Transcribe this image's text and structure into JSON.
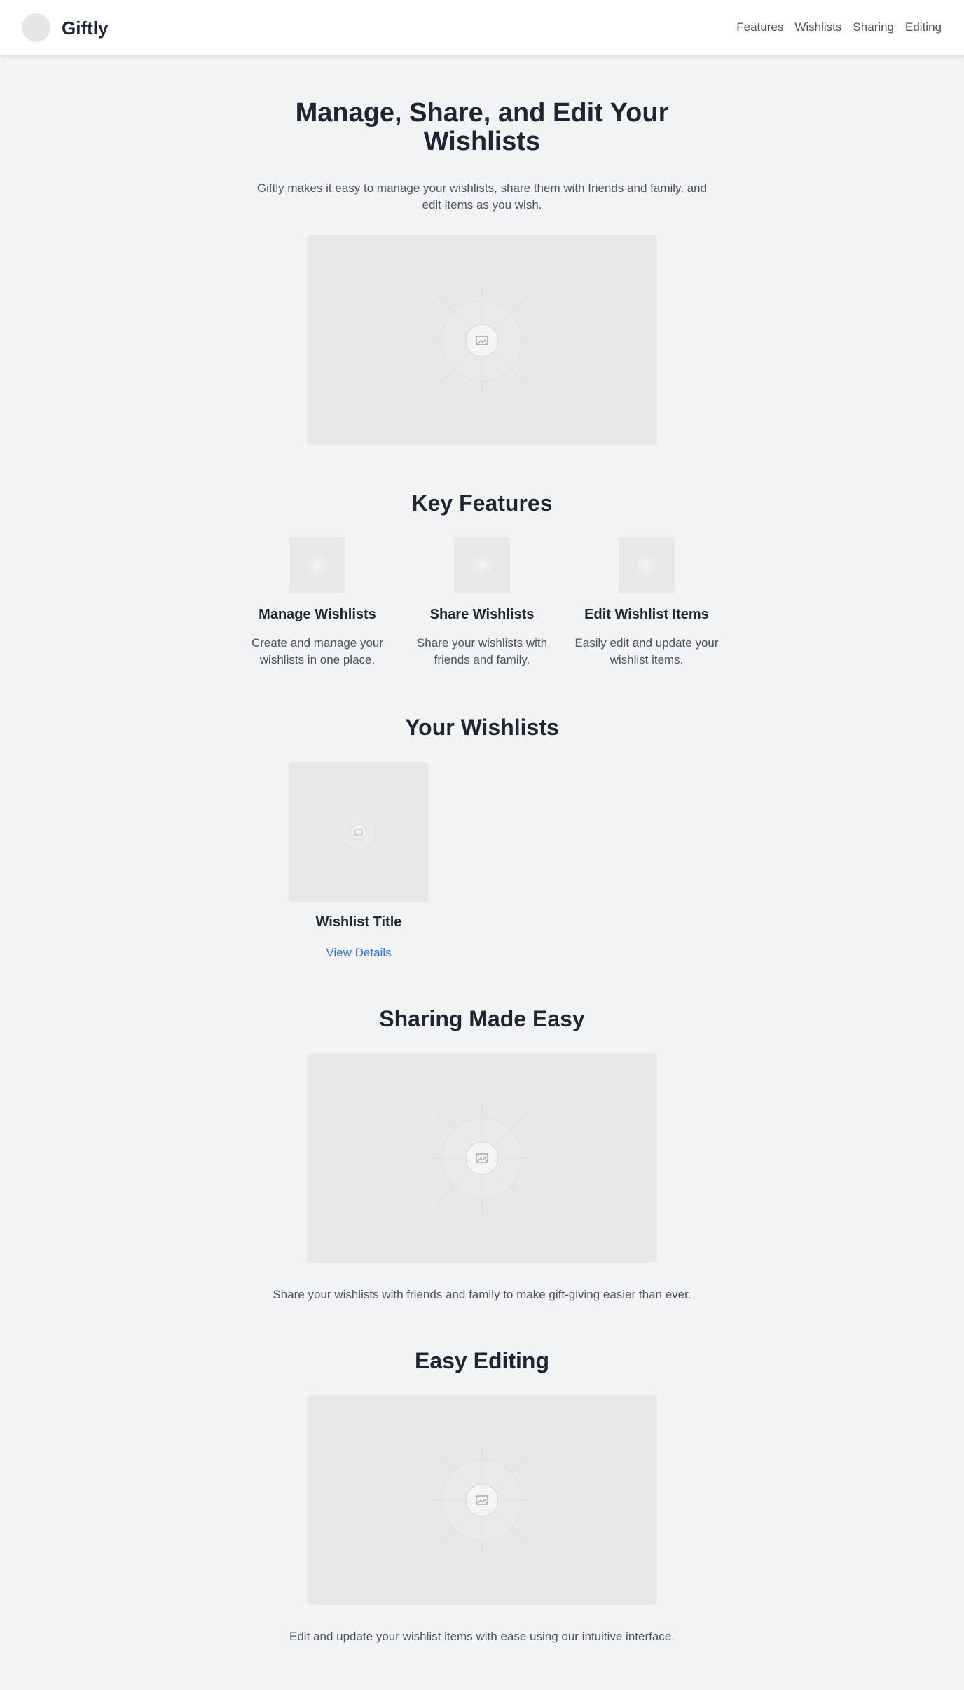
{
  "header": {
    "brand": "Giftly",
    "nav": [
      "Features",
      "Wishlists",
      "Sharing",
      "Editing"
    ]
  },
  "hero": {
    "title": "Manage, Share, and Edit Your Wishlists",
    "subtitle": "Giftly makes it easy to manage your wishlists, share them with friends and family, and edit items as you wish."
  },
  "features": {
    "title": "Key Features",
    "items": [
      {
        "title": "Manage Wishlists",
        "desc": "Create and manage your wishlists in one place."
      },
      {
        "title": "Share Wishlists",
        "desc": "Share your wishlists with friends and family."
      },
      {
        "title": "Edit Wishlist Items",
        "desc": "Easily edit and update your wishlist items."
      }
    ]
  },
  "wishlists": {
    "title": "Your Wishlists",
    "cards": [
      {
        "title": "Wishlist Title",
        "link": "View Details"
      }
    ]
  },
  "sharing": {
    "title": "Sharing Made Easy",
    "text": "Share your wishlists with friends and family to make gift-giving easier than ever."
  },
  "editing": {
    "title": "Easy Editing",
    "text": "Edit and update your wishlist items with ease using our intuitive interface."
  },
  "colors": {
    "background": "#f2f3f5",
    "header": "#ffffff",
    "heading": "#1f2633",
    "body_text": "#4b5260",
    "link": "#3b73c4",
    "placeholder": "#e8e8e8"
  }
}
